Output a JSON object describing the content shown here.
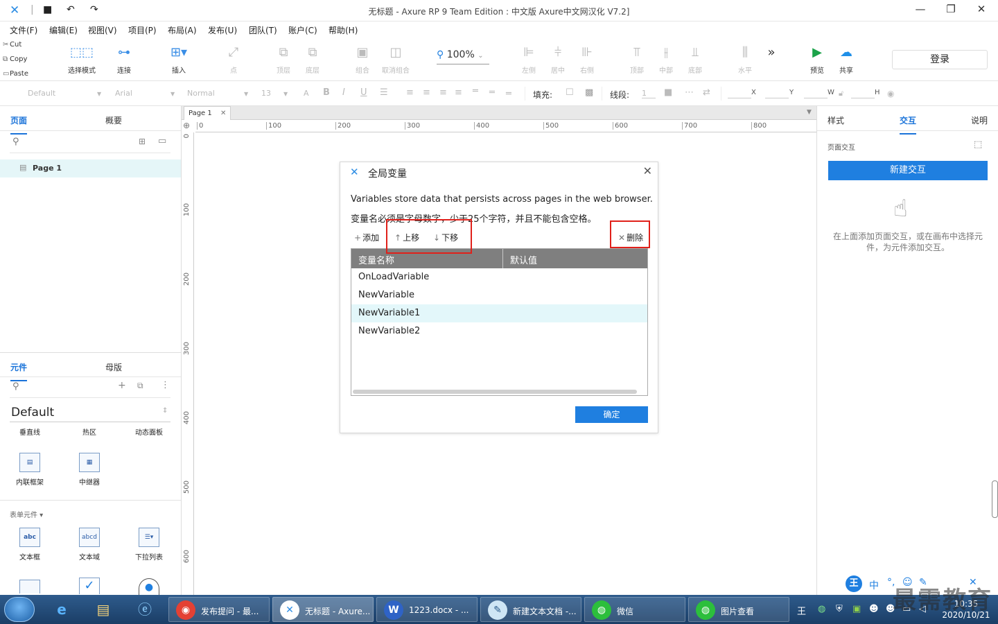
{
  "app": {
    "window_title": "无标题 - Axure RP 9 Team Edition : 中文版     Axure中文网汉化 V7.2]",
    "login_label": "登录"
  },
  "menu": [
    "文件(F)",
    "编辑(E)",
    "视图(V)",
    "项目(P)",
    "布局(A)",
    "发布(U)",
    "团队(T)",
    "账户(C)",
    "帮助(H)"
  ],
  "clipboard": {
    "cut": "Cut",
    "copy": "Copy",
    "paste": "Paste"
  },
  "toolbar": {
    "select_mode": "选择模式",
    "connect": "连接",
    "insert": "插入",
    "point": "点",
    "top_layer": "顶层",
    "bottom_layer": "底层",
    "group": "组合",
    "ungroup": "取消组合",
    "zoom": "100%",
    "left": "左侧",
    "center": "居中",
    "right": "右侧",
    "top": "顶部",
    "middle": "中部",
    "bottom": "底部",
    "horizontal": "水平",
    "more": "»",
    "preview": "预览",
    "share": "共享"
  },
  "format": {
    "style": "Default",
    "font": "Arial",
    "weight": "Normal",
    "size": "13",
    "fill_label": "填充:",
    "stroke_label": "线段:",
    "stroke_value": "1",
    "x": "X",
    "y": "Y",
    "w": "W",
    "h": "H"
  },
  "left_panel": {
    "tabs": [
      "页面",
      "概要"
    ],
    "page_name": "Page 1",
    "lib_tabs": [
      "元件",
      "母版"
    ],
    "library": "Default",
    "row1": [
      "垂直线",
      "热区",
      "动态面板"
    ],
    "row2": [
      "内联框架",
      "中继器"
    ],
    "form_section": "表单元件 ▾",
    "row3": [
      "文本框",
      "文本域",
      "下拉列表"
    ]
  },
  "canvas": {
    "page_tab": "Page 1",
    "hruler": [
      "0",
      "100",
      "200",
      "300",
      "400",
      "500",
      "600",
      "700",
      "800"
    ],
    "vruler": [
      "0",
      "100",
      "200",
      "300",
      "400",
      "500",
      "600"
    ]
  },
  "dialog": {
    "title": "全局变量",
    "desc_en": "Variables store data that persists across pages in the web browser.",
    "desc_cn": "变量名必须是字母数字，少于25个字符，并且不能包含空格。",
    "add": "添加",
    "move_up": "上移",
    "move_down": "下移",
    "delete": "删除",
    "col_name": "变量名称",
    "col_default": "默认值",
    "variables": [
      "OnLoadVariable",
      "NewVariable",
      "NewVariable1",
      "NewVariable2"
    ],
    "selected_index": 2,
    "ok": "确定"
  },
  "right_panel": {
    "tabs": [
      "样式",
      "交互",
      "说明"
    ],
    "section": "页面交互",
    "new_interaction": "新建交互",
    "hint": "在上面添加页面交互，或在画布中选择元件，为元件添加交互。"
  },
  "taskbar": {
    "tasks": [
      "发布提问 - 最...",
      "无标题 - Axure...",
      "1223.docx - ...",
      "新建文本文档 -...",
      "微信",
      "图片查看"
    ],
    "time": "10:35",
    "date": "2020/10/21",
    "watermark": "最需教育"
  },
  "colors": {
    "accent": "#1f7fe0",
    "highlight_box": "#e0201a",
    "selected_row": "#e3f7fa",
    "table_header": "#7f7f7f"
  }
}
